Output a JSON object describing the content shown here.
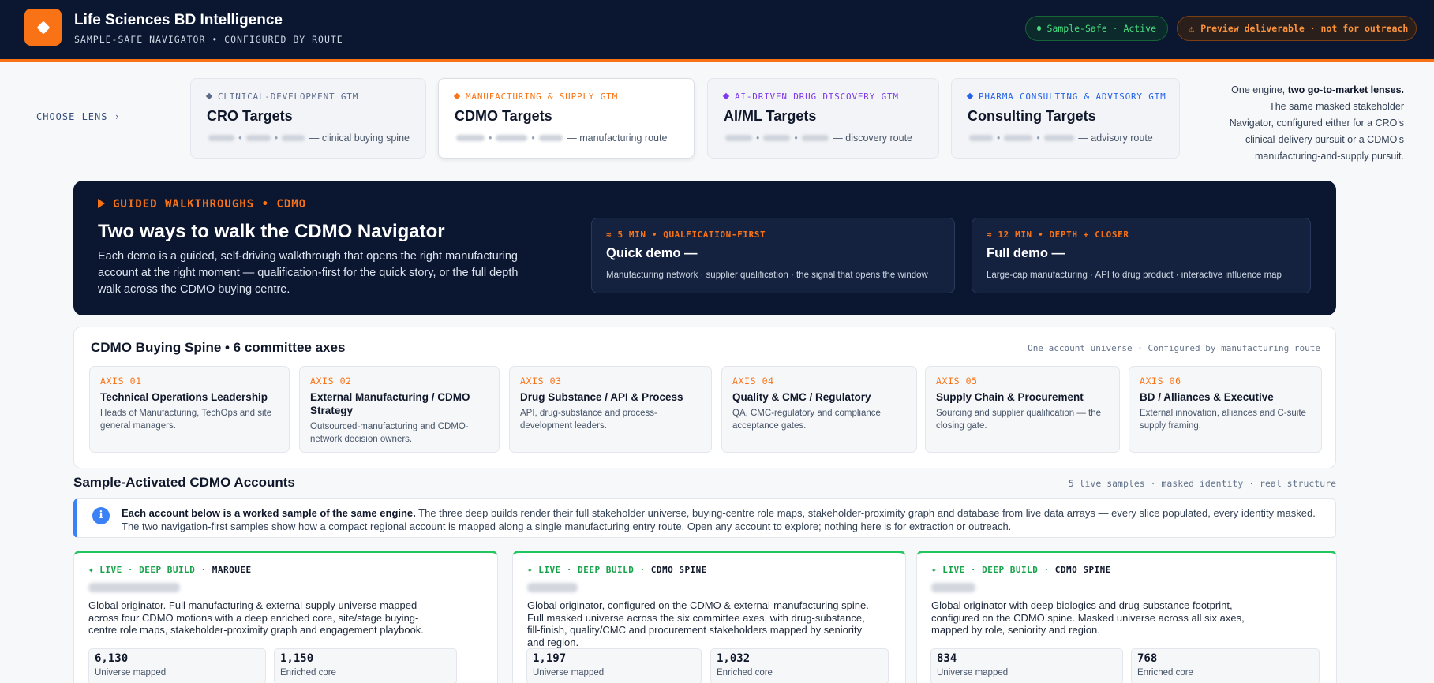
{
  "header": {
    "app_title": "Life Sciences BD Intelligence",
    "app_subtitle": "SAMPLE-SAFE NAVIGATOR • CONFIGURED BY ROUTE",
    "status_pill": "Sample-Safe · Active",
    "preview_pill": "Preview deliverable · not for outreach"
  },
  "lenses": {
    "choose_label": "CHOOSE LENS ›",
    "note_intro": "One engine, ",
    "note_bold": "two go-to-market lenses.",
    "note_rest": " The same masked stakeholder Navigator, configured either for a CRO's clinical-delivery pursuit or a CDMO's manufacturing-and-supply pursuit.",
    "items": [
      {
        "tag": "CLINICAL-DEVELOPMENT GTM",
        "title": "CRO Targets",
        "desc": "— clinical buying spine",
        "color": "#5b6b8c"
      },
      {
        "tag": "MANUFACTURING & SUPPLY GTM",
        "title": "CDMO Targets",
        "desc": "— manufacturing route",
        "color": "#f97316"
      },
      {
        "tag": "AI-DRIVEN DRUG DISCOVERY GTM",
        "title": "AI/ML Targets",
        "desc": "— discovery route",
        "color": "#7c3aed"
      },
      {
        "tag": "PHARMA CONSULTING & ADVISORY GTM",
        "title": "Consulting Targets",
        "desc": "— advisory route",
        "color": "#2563eb"
      }
    ]
  },
  "walkthrough": {
    "tag": "GUIDED WALKTHROUGHS • CDMO",
    "title": "Two ways to walk the CDMO Navigator",
    "desc": "Each demo is a guided, self-driving walkthrough that opens the right manufacturing account at the right moment — qualification-first for the quick story, or the full depth walk across the CDMO buying centre.",
    "demos": [
      {
        "tag": "≈ 5 MIN • QUALFICATION-FIRST",
        "title": "Quick demo —",
        "desc": "Manufacturing network · supplier qualification · the signal that opens the window"
      },
      {
        "tag": "≈ 12 MIN • DEPTH + CLOSER",
        "title": "Full demo —",
        "desc": "Large-cap manufacturing · API to drug product · interactive influence map"
      }
    ]
  },
  "spine": {
    "title": "CDMO Buying Spine • 6 committee axes",
    "note": "One account universe · Configured by manufacturing route",
    "axes": [
      {
        "num": "AXIS 01",
        "title": "Technical Operations Leadership",
        "desc": "Heads of Manufacturing, TechOps and site general managers."
      },
      {
        "num": "AXIS 02",
        "title": "External Manufacturing / CDMO Strategy",
        "desc": "Outsourced-manufacturing and CDMO-network decision owners."
      },
      {
        "num": "AXIS 03",
        "title": "Drug Substance / API & Process",
        "desc": "API, drug-substance and process-development leaders."
      },
      {
        "num": "AXIS 04",
        "title": "Quality & CMC / Regulatory",
        "desc": "QA, CMC-regulatory and compliance acceptance gates."
      },
      {
        "num": "AXIS 05",
        "title": "Supply Chain & Procurement",
        "desc": "Sourcing and supplier qualification — the closing gate."
      },
      {
        "num": "AXIS 06",
        "title": "BD / Alliances & Executive",
        "desc": "External innovation, alliances and C-suite supply framing."
      }
    ]
  },
  "accounts": {
    "title": "Sample-Activated CDMO Accounts",
    "note": "5 live samples · masked identity · real structure",
    "info_bold": "Each account below is a worked sample of the same engine.",
    "info_rest": " The three deep builds render their full stakeholder universe, buying-centre role maps, stakeholder-proximity graph and database from live data arrays — every slice populated, every identity masked. The two navigation-first samples show how a compact regional account is mapped along a single manufacturing entry route. Open any account to explore; nothing here is for extraction or outreach.",
    "cards": [
      {
        "live": "✦ LIVE · DEEP BUILD · ",
        "kind": "MARQUEE",
        "desc": "Global originator. Full manufacturing & external-supply universe mapped across four CDMO motions with a deep enriched core, site/stage buying-centre role maps, stakeholder-proximity graph and engagement playbook.",
        "stat1_val": "6,130",
        "stat1_lbl": "Universe mapped",
        "stat2_val": "1,150",
        "stat2_lbl": "Enriched core"
      },
      {
        "live": "✦ LIVE · DEEP BUILD · ",
        "kind": "CDMO SPINE",
        "desc": "Global originator, configured on the CDMO & external-manufacturing spine. Full masked universe across the six committee axes, with drug-substance, fill-finish, quality/CMC and procurement stakeholders mapped by seniority and region.",
        "stat1_val": "1,197",
        "stat1_lbl": "Universe mapped",
        "stat2_val": "1,032",
        "stat2_lbl": "Enriched core"
      },
      {
        "live": "✦ LIVE · DEEP BUILD · ",
        "kind": "CDMO SPINE",
        "desc": "Global originator with deep biologics and drug-substance footprint, configured on the CDMO spine. Masked universe across all six axes, mapped by role, seniority and region.",
        "stat1_val": "834",
        "stat1_lbl": "Universe mapped",
        "stat2_val": "768",
        "stat2_lbl": "Enriched core"
      }
    ]
  }
}
